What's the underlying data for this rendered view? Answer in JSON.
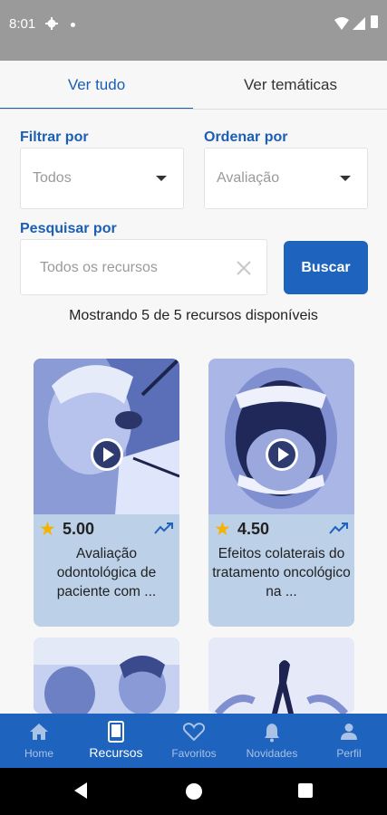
{
  "status_bar": {
    "time": "8:01"
  },
  "tabs": [
    {
      "label": "Ver tudo"
    },
    {
      "label": "Ver temáticas"
    }
  ],
  "filter": {
    "label": "Filtrar por",
    "value": "Todos"
  },
  "sort": {
    "label": "Ordenar por",
    "value": "Avaliação"
  },
  "search": {
    "label": "Pesquisar por",
    "placeholder": "Todos os recursos",
    "button": "Buscar"
  },
  "results": {
    "count_text": "Mostrando 5 de 5 recursos disponíveis"
  },
  "cards": [
    {
      "rating": "5.00",
      "title": "Avaliação odontológica de paciente com ..."
    },
    {
      "rating": "4.50",
      "title": "Efeitos colaterais do tratamento oncológico na ..."
    },
    {
      "rating": "",
      "title": ""
    },
    {
      "rating": "",
      "title": ""
    }
  ],
  "bottom_nav": [
    {
      "label": "Home",
      "icon": "home-icon"
    },
    {
      "label": "Recursos",
      "icon": "tablet-icon"
    },
    {
      "label": "Favoritos",
      "icon": "heart-icon"
    },
    {
      "label": "Novidades",
      "icon": "bell-icon"
    },
    {
      "label": "Perfil",
      "icon": "person-icon"
    }
  ],
  "colors": {
    "primary": "#1e63be",
    "card_bg": "#bcd0e8",
    "star": "#f5b301",
    "status_bar": "#9a9a9a"
  }
}
